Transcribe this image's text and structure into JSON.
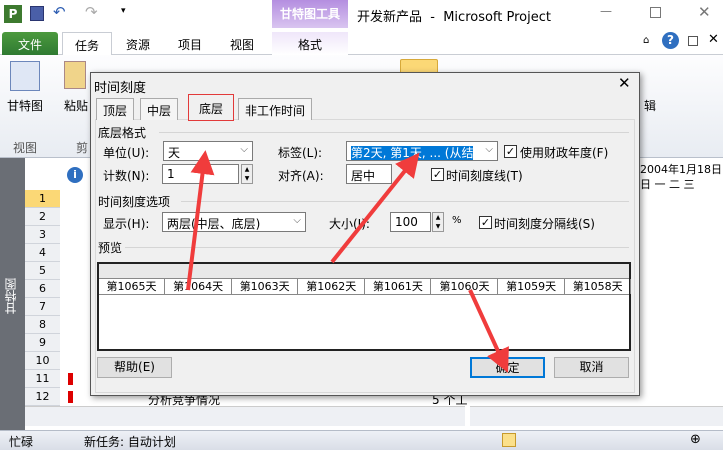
{
  "app": {
    "title": "开发新产品  -  Microsoft Project",
    "context_tab_group": "甘特图工具",
    "logo": "P"
  },
  "ribbon": {
    "tabs": [
      "文件",
      "任务",
      "资源",
      "项目",
      "视图",
      "格式"
    ],
    "groups": {
      "view_button": "甘特图",
      "view_group": "视图",
      "paste_button": "粘贴",
      "clipboard_group": "剪",
      "edit_fragment": "辑"
    }
  },
  "sheet": {
    "side_label": "甘特图",
    "rows": [
      "1",
      "2",
      "3",
      "4",
      "5",
      "6",
      "7",
      "8",
      "9",
      "10",
      "11",
      "12"
    ],
    "task_12_name": "分析竞争情况",
    "task_12_duration": "5 个工",
    "timescale_date": "2004年1月18日",
    "timescale_days": "日 一 二 三"
  },
  "status": {
    "mode": "忙碌",
    "new_task": "新任务: 自动计划"
  },
  "dialog": {
    "title": "时间刻度",
    "tabs": [
      "顶层",
      "中层",
      "底层",
      "非工作时间"
    ],
    "active_tab": "底层",
    "section_format": "底层格式",
    "unit_label": "单位(U):",
    "unit_value": "天",
    "label_label": "标签(L):",
    "label_value": "第2天, 第1天, ... (从结",
    "fiscal_label": "使用财政年度(F)",
    "fiscal_checked": true,
    "count_label": "计数(N):",
    "count_value": "1",
    "align_label": "对齐(A):",
    "align_value": "居中",
    "tickline_label": "时间刻度线(T)",
    "tickline_checked": true,
    "section_options": "时间刻度选项",
    "show_label": "显示(H):",
    "show_value": "两层(中层、底层)",
    "size_label": "大小(I):",
    "size_value": "100",
    "size_unit": "%",
    "separator_label": "时间刻度分隔线(S)",
    "separator_checked": true,
    "section_preview": "预览",
    "preview_cells": [
      "第1065天",
      "第1064天",
      "第1063天",
      "第1062天",
      "第1061天",
      "第1060天",
      "第1059天",
      "第1058天"
    ],
    "help_button": "帮助(E)",
    "ok_button": "确定",
    "cancel_button": "取消"
  },
  "colors": {
    "file_tab": "#2f7a32",
    "context_tab": "#a77fd6",
    "selection": "#0078d7",
    "arrow": "#f03c3c",
    "tab_highlight": "#e23a3a"
  }
}
